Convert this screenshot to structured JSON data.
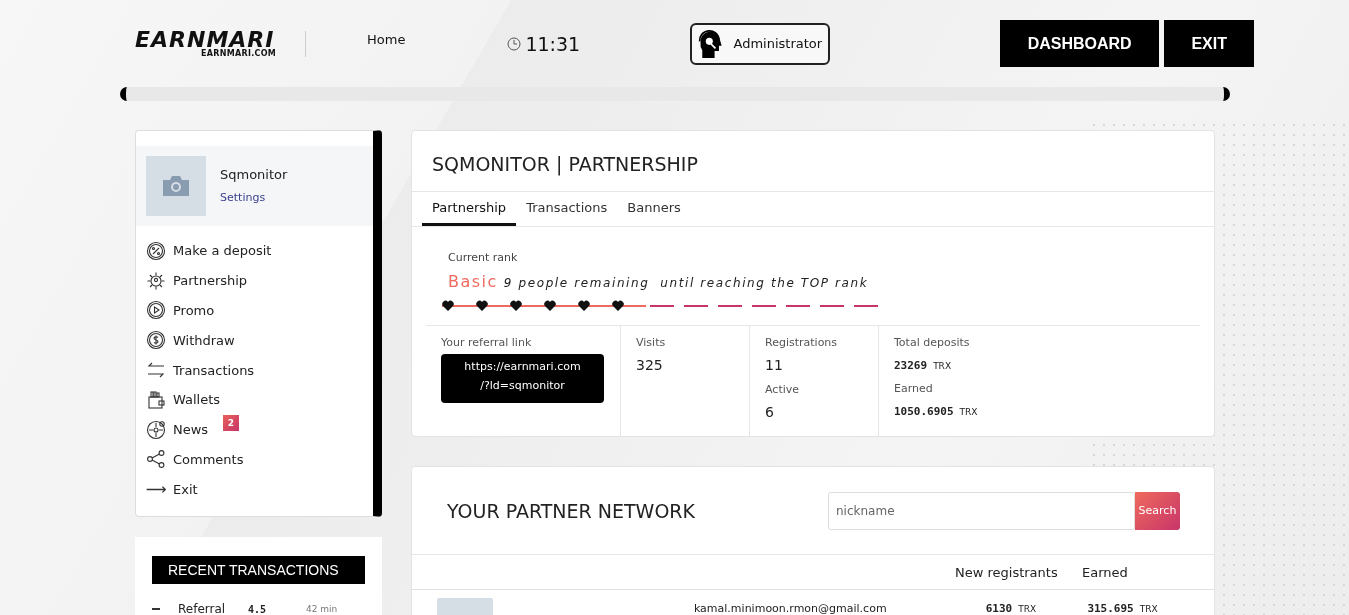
{
  "header": {
    "logo": "EARNMARI",
    "logo_subtitle": "EARNMARI.COM",
    "nav_link": "Home",
    "time": "11:31",
    "user": "Administrator",
    "buttons": [
      "DASHBOARD",
      "EXIT"
    ]
  },
  "sidebar": {
    "profile": {
      "name": "Sqmonitor",
      "settings_link": "Settings"
    },
    "menu": [
      {
        "label": "Make a deposit"
      },
      {
        "label": "Partnership"
      },
      {
        "label": "Promo"
      },
      {
        "label": "Withdraw"
      },
      {
        "label": "Transactions"
      },
      {
        "label": "Wallets"
      },
      {
        "label": "News",
        "badge": "2"
      },
      {
        "label": "Comments"
      },
      {
        "label": "Exit"
      }
    ]
  },
  "recent_transactions": {
    "title": "RECENT TRANSACTIONS",
    "rows": [
      {
        "type": "Referral",
        "amount": "4.5",
        "time": "42 min"
      }
    ]
  },
  "partnership": {
    "title": "SQMONITOR | PARTNERSHIP",
    "tabs": [
      {
        "label": "Partnership",
        "selected": true
      },
      {
        "label": "Transactions",
        "selected": false
      },
      {
        "label": "Banners",
        "selected": false
      }
    ],
    "rank": {
      "label": "Current rank",
      "name": "Basic",
      "note": "9 people remaining  until reaching the TOP rank",
      "steps": [
        {
          "reached": true
        },
        {
          "reached": true
        },
        {
          "reached": true
        },
        {
          "reached": true
        },
        {
          "reached": true
        },
        {
          "reached": true
        },
        {
          "reached": false
        },
        {
          "reached": false
        },
        {
          "reached": false
        },
        {
          "reached": false
        },
        {
          "reached": false
        },
        {
          "reached": false
        },
        {
          "reached": false
        }
      ]
    },
    "referral": {
      "label": "Your referral link",
      "link_lines": [
        "https://earnmari.com",
        "/?ld=sqmonitor"
      ]
    },
    "visits": {
      "label": "Visits",
      "value": "325"
    },
    "registrations": {
      "label": "Registrations",
      "value": "11"
    },
    "active": {
      "label": "Active",
      "value": "6"
    },
    "total_deposits": {
      "label": "Total deposits",
      "value": "23269",
      "unit": "TRX"
    },
    "earned": {
      "label": "Earned",
      "value": "1050.6905",
      "unit": "TRX"
    }
  },
  "network": {
    "title": "YOUR PARTNER NETWORK",
    "search": {
      "placeholder": "nickname",
      "button": "Search"
    },
    "columns": [
      "New registrants",
      "Earned"
    ],
    "rows": [
      {
        "email": "kamal.minimoon.rmon@gmail.com",
        "registrants": "6130",
        "registrants_unit": "TRX",
        "earned": "315.695",
        "earned_unit": "TRX"
      }
    ]
  }
}
